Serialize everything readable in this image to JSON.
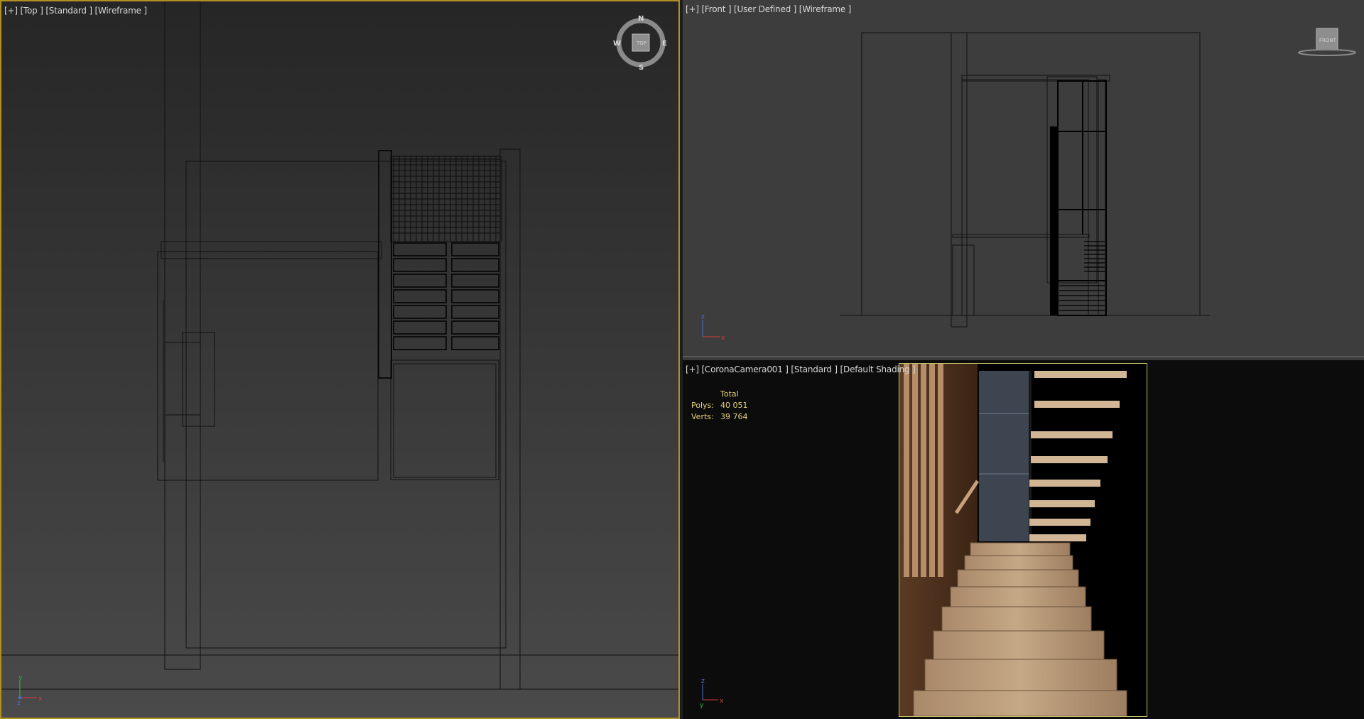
{
  "viewports": {
    "top": {
      "label_parts": [
        "[+]",
        "[Top ]",
        "[Standard ]",
        "[Wireframe ]"
      ],
      "viewcube": {
        "n": "N",
        "s": "S",
        "e": "E",
        "w": "W",
        "face": "TOP"
      }
    },
    "front": {
      "label_parts": [
        "[+]",
        "[Front ]",
        "[User Defined ]",
        "[Wireframe ]"
      ],
      "viewcube": {
        "face": "FRONT"
      }
    },
    "camera": {
      "label_parts": [
        "[+]",
        "[CoronaCamera001 ]",
        "[Standard ]",
        "[Default Shading ]"
      ],
      "stats": {
        "header": "Total",
        "polys_label": "Polys:",
        "polys_value": "40 051",
        "verts_label": "Verts:",
        "verts_value": "39 764"
      }
    }
  },
  "gizmo": {
    "x": "x",
    "y": "y",
    "z": "z"
  },
  "colors": {
    "active_border": "#b09020",
    "stats_text": "#e4d47a",
    "render_frame": "#c7c16a",
    "wood": "#b89a78"
  }
}
